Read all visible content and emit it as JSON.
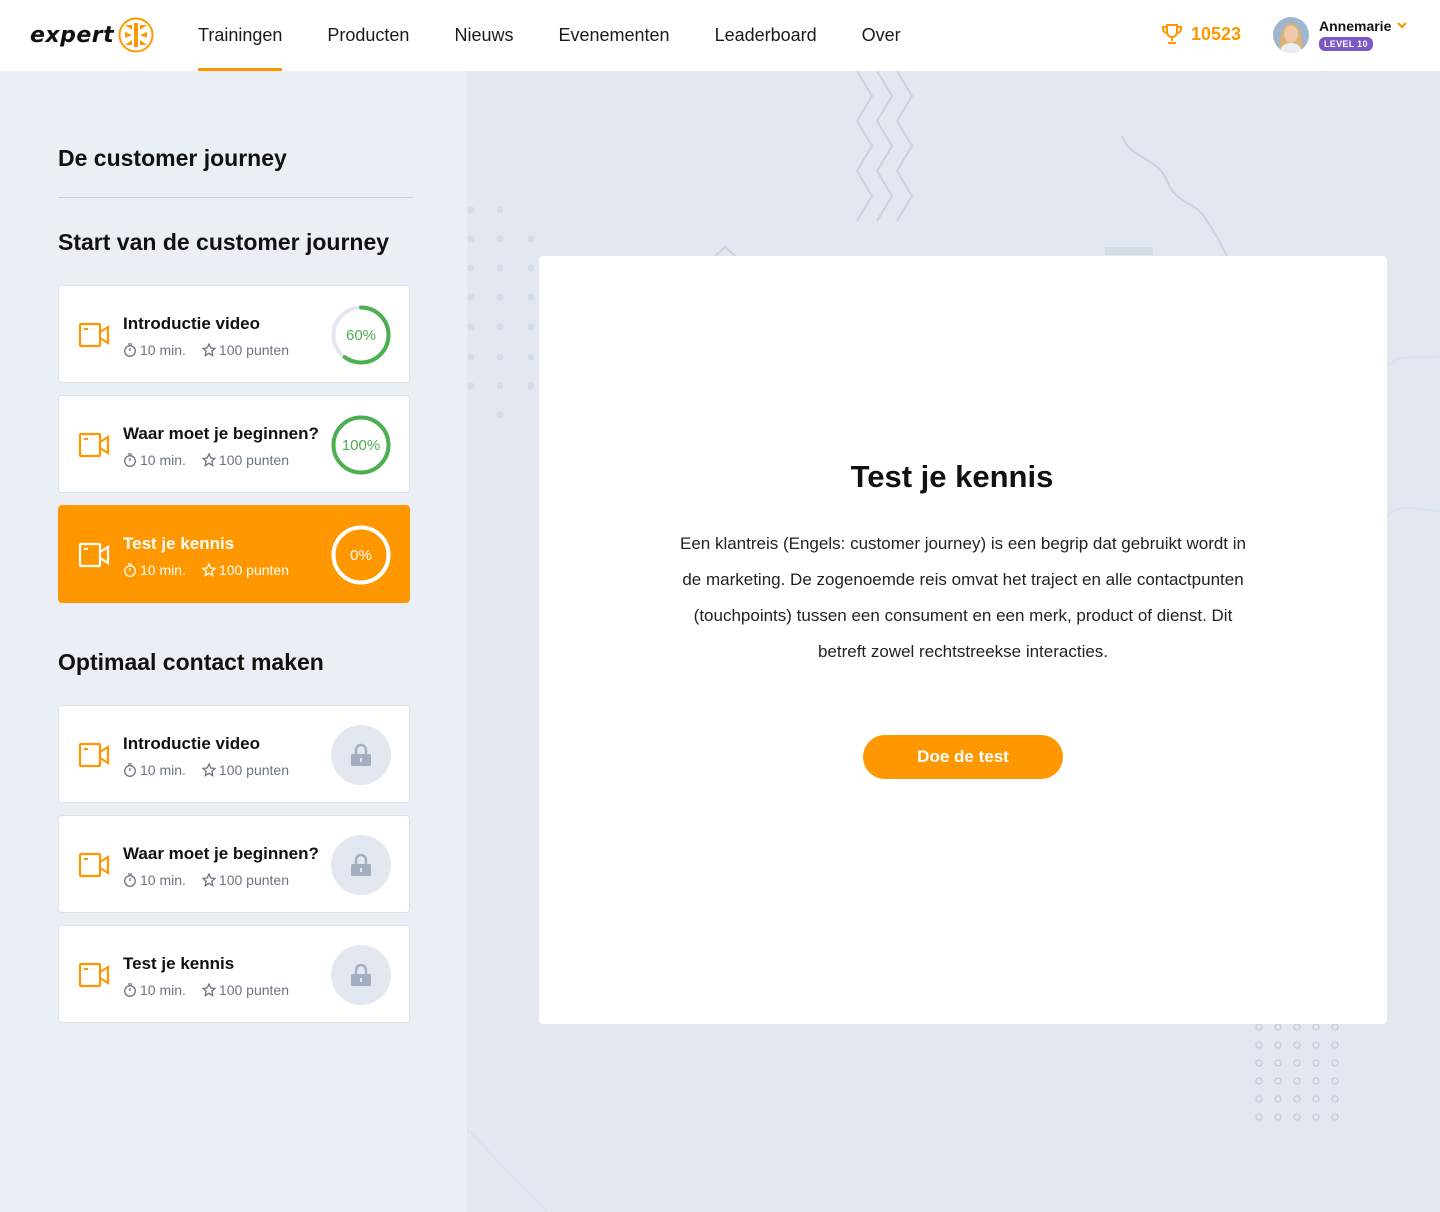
{
  "brand": {
    "logo_text": "expert",
    "accent": "#ff9800",
    "purple": "#7b57c7",
    "green": "#4caf50"
  },
  "nav": {
    "items": [
      {
        "label": "Trainingen",
        "active": true
      },
      {
        "label": "Producten"
      },
      {
        "label": "Nieuws"
      },
      {
        "label": "Evenementen"
      },
      {
        "label": "Leaderboard"
      },
      {
        "label": "Over"
      }
    ]
  },
  "header": {
    "points": "10523",
    "points_icon": "trophy-icon",
    "user_name": "Annemarie",
    "user_level": "LEVEL 10"
  },
  "sidebar": {
    "course_title": "De customer journey",
    "sections": [
      {
        "title": "Start van de customer journey",
        "lessons": [
          {
            "title": "Introductie video",
            "duration": "10 min.",
            "points": "100 punten",
            "progress": 0.6,
            "progress_label": "60%",
            "state": "in-progress"
          },
          {
            "title": "Waar moet je beginnen?",
            "duration": "10 min.",
            "points": "100 punten",
            "progress": 1.0,
            "progress_label": "100%",
            "state": "completed"
          },
          {
            "title": "Test je kennis",
            "duration": "10 min.",
            "points": "100 punten",
            "progress": 0,
            "progress_label": "0%",
            "state": "active"
          }
        ]
      },
      {
        "title": "Optimaal contact maken",
        "lessons": [
          {
            "title": "Introductie video",
            "duration": "10 min.",
            "points": "100 punten",
            "state": "locked"
          },
          {
            "title": "Waar moet je beginnen?",
            "duration": "10 min.",
            "points": "100 punten",
            "state": "locked"
          },
          {
            "title": "Test je kennis",
            "duration": "10 min.",
            "points": "100 punten",
            "state": "locked"
          }
        ]
      }
    ]
  },
  "main": {
    "title": "Test je kennis",
    "text": "Een klantreis (Engels: customer journey) is een begrip dat gebruikt wordt in de marketing. De zogenoemde reis omvat het traject en alle contactpunten (touchpoints) tussen een consument en een merk, product of dienst. Dit betreft zowel rechtstreekse interacties.",
    "button_label": "Doe de test"
  }
}
